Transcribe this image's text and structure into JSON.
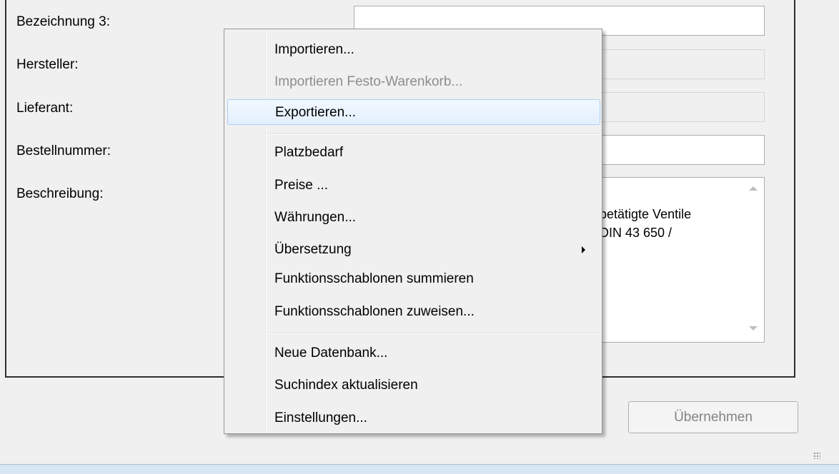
{
  "form": {
    "labels": [
      "Bezeichnung 3:",
      "Hersteller:",
      "Lieferant:",
      "Bestellnummer:",
      "Beschreibung:"
    ],
    "description_visible": "betätigte Ventile\nDIN 43 650 /",
    "apply_button": "Übernehmen"
  },
  "context_menu": {
    "items": [
      {
        "label": "Importieren...",
        "enabled": true
      },
      {
        "label": "Importieren Festo-Warenkorb...",
        "enabled": false
      },
      {
        "label": "Exportieren...",
        "enabled": true,
        "highlighted": true
      },
      {
        "label": "Platzbedarf",
        "enabled": true
      },
      {
        "label": "Preise ...",
        "enabled": true
      },
      {
        "label": "Währungen...",
        "enabled": true
      },
      {
        "label": "Übersetzung",
        "enabled": true,
        "submenu": true
      },
      {
        "label": "Funktionsschablonen summieren",
        "enabled": true
      },
      {
        "label": "Funktionsschablonen zuweisen...",
        "enabled": true
      },
      {
        "label": "Neue Datenbank...",
        "enabled": true
      },
      {
        "label": "Suchindex aktualisieren",
        "enabled": true
      },
      {
        "label": "Einstellungen...",
        "enabled": true
      }
    ]
  },
  "icons": [
    "submenu-arrow-icon",
    "scroll-up-icon",
    "scroll-down-icon",
    "resize-grip-icon"
  ],
  "colors": {
    "highlight_border": "#aecff7",
    "disabled_text": "#8d8d8d"
  }
}
